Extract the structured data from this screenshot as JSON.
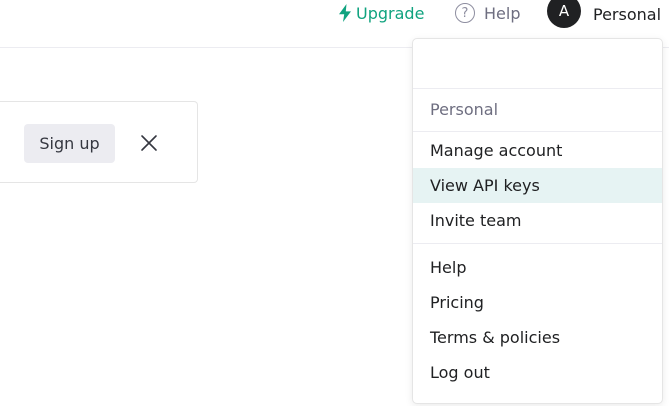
{
  "header": {
    "upgrade_label": "Upgrade",
    "help_label": "Help",
    "help_icon_glyph": "?",
    "avatar_initial": "A",
    "account_name": "Personal"
  },
  "banner": {
    "signup_label": "Sign up"
  },
  "menu": {
    "section_label": "Personal",
    "account_items": [
      {
        "label": "Manage account"
      },
      {
        "label": "View API keys"
      },
      {
        "label": "Invite team"
      }
    ],
    "support_items": [
      {
        "label": "Help"
      },
      {
        "label": "Pricing"
      },
      {
        "label": "Terms & policies"
      },
      {
        "label": "Log out"
      }
    ]
  },
  "colors": {
    "accent": "#10a37f",
    "hover_bg": "#e6f3f3",
    "avatar_bg": "#202123"
  }
}
